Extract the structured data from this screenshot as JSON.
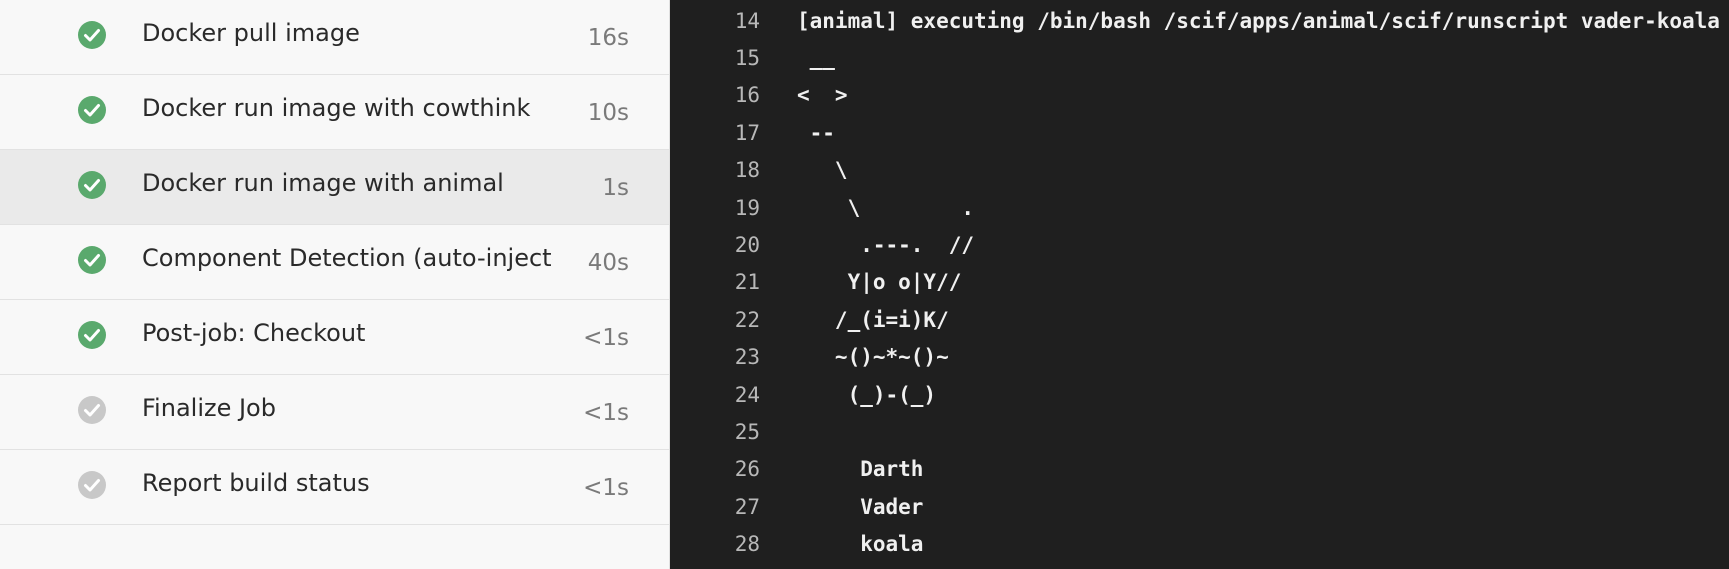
{
  "colors": {
    "success": "#5aa96d",
    "skipped": "#c8c8c8",
    "log_background": "#1f1f1f",
    "list_background": "#f8f8f8",
    "selected_row": "#eaeaea"
  },
  "steps": [
    {
      "name": "Docker pull image",
      "duration": "16s",
      "status": "success",
      "icon": "check-circle-icon"
    },
    {
      "name": "Docker run image with cowthink",
      "duration": "10s",
      "status": "success",
      "icon": "check-circle-icon"
    },
    {
      "name": "Docker run image with animal",
      "duration": "1s",
      "status": "success",
      "icon": "check-circle-icon",
      "selected": true
    },
    {
      "name": "Component Detection (auto-injecte",
      "duration": "40s",
      "status": "success",
      "icon": "check-circle-icon"
    },
    {
      "name": "Post-job: Checkout",
      "duration": "<1s",
      "status": "success",
      "icon": "check-circle-icon"
    },
    {
      "name": "Finalize Job",
      "duration": "<1s",
      "status": "skipped",
      "icon": "check-circle-icon"
    },
    {
      "name": "Report build status",
      "duration": "<1s",
      "status": "skipped",
      "icon": "check-circle-icon"
    }
  ],
  "log": {
    "lines": [
      {
        "num": "14",
        "text": "[animal] executing /bin/bash /scif/apps/animal/scif/runscript vader-koala"
      },
      {
        "num": "15",
        "text": " __"
      },
      {
        "num": "16",
        "text": "<  >"
      },
      {
        "num": "17",
        "text": " --"
      },
      {
        "num": "18",
        "text": "   \\"
      },
      {
        "num": "19",
        "text": "    \\        ."
      },
      {
        "num": "20",
        "text": "     .---.  //"
      },
      {
        "num": "21",
        "text": "    Y|o o|Y//"
      },
      {
        "num": "22",
        "text": "   /_(i=i)K/"
      },
      {
        "num": "23",
        "text": "   ~()~*~()~"
      },
      {
        "num": "24",
        "text": "    (_)-(_)"
      },
      {
        "num": "25",
        "text": ""
      },
      {
        "num": "26",
        "text": "     Darth"
      },
      {
        "num": "27",
        "text": "     Vader"
      },
      {
        "num": "28",
        "text": "     koala"
      }
    ]
  }
}
